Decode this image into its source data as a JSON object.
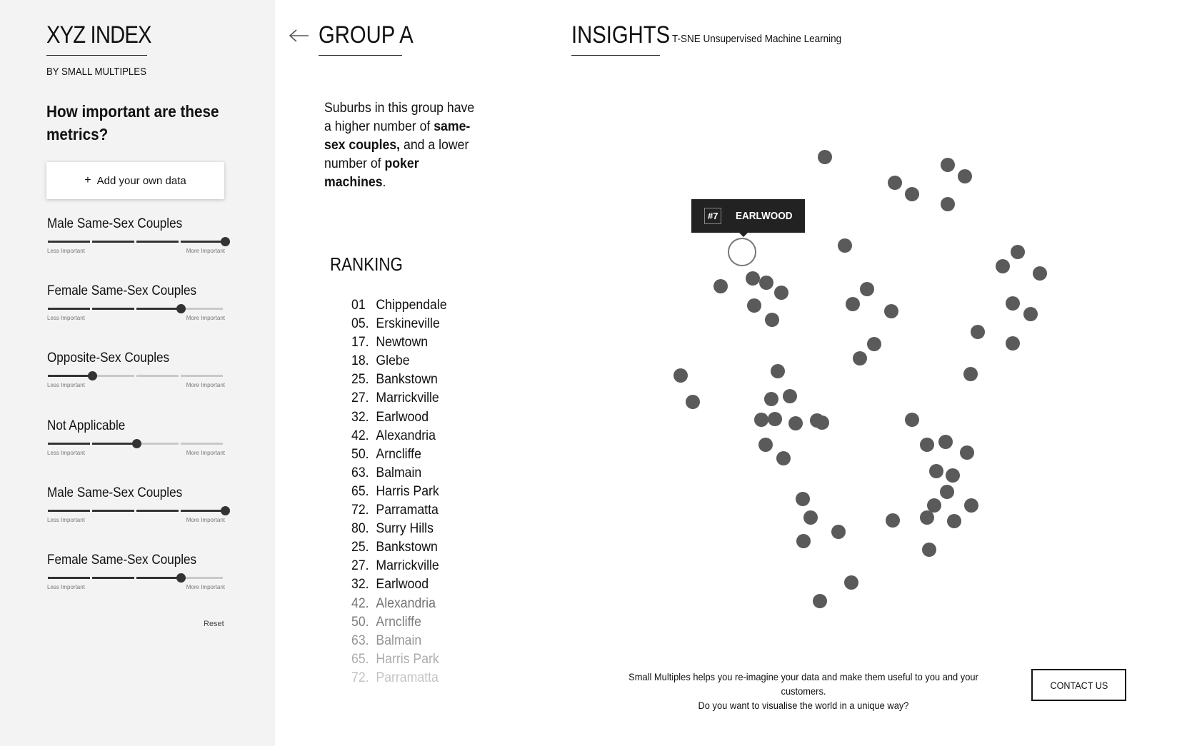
{
  "brand": {
    "title": "XYZ INDEX",
    "subtitle": "BY SMALL MULTIPLES"
  },
  "sidebar": {
    "question": "How important are these metrics?",
    "add_button": {
      "icon": "plus-icon",
      "label": "Add your own data"
    },
    "low_label": "Less Important",
    "high_label": "More Important",
    "reset_label": "Reset",
    "metrics": [
      {
        "label": "Male Same-Sex Couples",
        "level": 4
      },
      {
        "label": "Female Same-Sex Couples",
        "level": 3
      },
      {
        "label": "Opposite-Sex Couples",
        "level": 1
      },
      {
        "label": "Not Applicable",
        "level": 2
      },
      {
        "label": "Male Same-Sex Couples",
        "level": 4
      },
      {
        "label": "Female Same-Sex Couples",
        "level": 3
      }
    ]
  },
  "group": {
    "back_icon": "arrow-left-icon",
    "title": "GROUP A",
    "desc": {
      "p1": "Suburbs in this group have a higher number of ",
      "b1": "same-sex couples,",
      "p2": " and a lower number of ",
      "b2": "poker machines",
      "p3": "."
    },
    "ranking_title": "RANKING",
    "ranking": [
      {
        "num": "01",
        "name": "Chippendale"
      },
      {
        "num": "05.",
        "name": "Erskineville"
      },
      {
        "num": "17.",
        "name": "Newtown"
      },
      {
        "num": "18.",
        "name": "Glebe"
      },
      {
        "num": "25.",
        "name": "Bankstown"
      },
      {
        "num": "27.",
        "name": "Marrickville"
      },
      {
        "num": "32.",
        "name": "Earlwood"
      },
      {
        "num": "42.",
        "name": "Alexandria"
      },
      {
        "num": "50.",
        "name": "Arncliffe"
      },
      {
        "num": "63.",
        "name": "Balmain"
      },
      {
        "num": "65.",
        "name": "Harris Park"
      },
      {
        "num": "72.",
        "name": "Parramatta"
      },
      {
        "num": "80.",
        "name": "Surry Hills"
      },
      {
        "num": "25.",
        "name": "Bankstown"
      },
      {
        "num": "27.",
        "name": "Marrickville"
      },
      {
        "num": "32.",
        "name": "Earlwood"
      },
      {
        "num": "42.",
        "name": "Alexandria"
      },
      {
        "num": "50.",
        "name": "Arncliffe"
      },
      {
        "num": "63.",
        "name": "Balmain"
      },
      {
        "num": "65.",
        "name": "Harris Park"
      },
      {
        "num": "72.",
        "name": "Parramatta"
      }
    ],
    "fade_opacity": [
      1,
      1,
      1,
      1,
      1,
      1,
      1,
      1,
      1,
      1,
      1,
      1,
      1,
      1,
      1,
      1,
      0.6,
      0.55,
      0.45,
      0.35,
      0.25
    ]
  },
  "insights": {
    "title": "INSIGHTS",
    "subtitle": "T-SNE Unsupervised Machine Learning",
    "tooltip": {
      "rank": "#7",
      "name": "EARLWOOD"
    },
    "colors": {
      "point": "#5a5a5a",
      "highlight_stroke": "#777777"
    }
  },
  "footer": {
    "line1": "Small Multiples helps you re-imagine your data and make them useful to you and your customers.",
    "line2": "Do you want to visualise the world in a unique way?",
    "contact_label": "CONTACT US"
  }
}
